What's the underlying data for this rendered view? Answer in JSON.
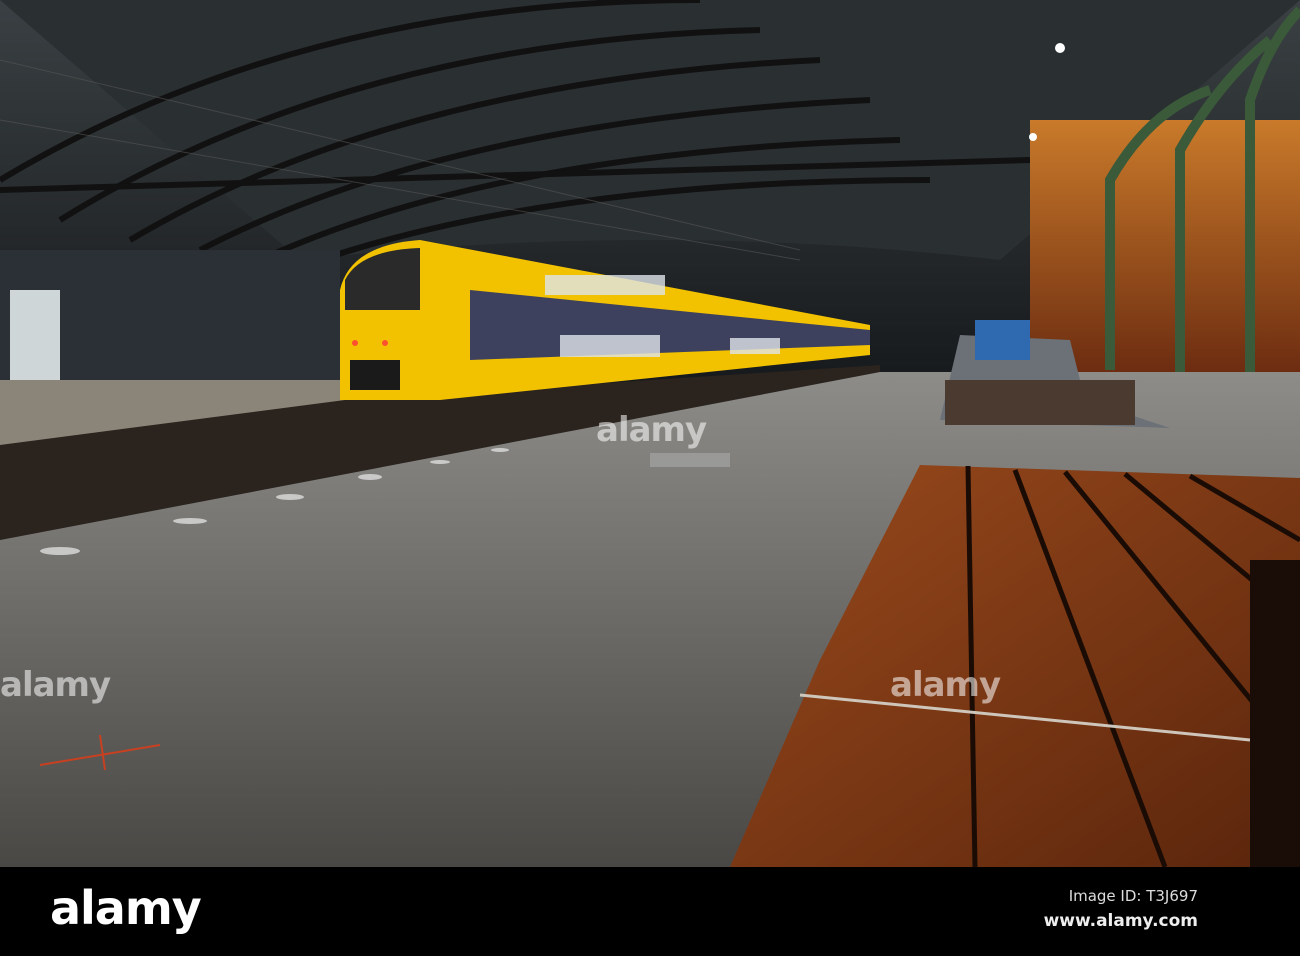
{
  "watermark": {
    "brand": "alamy"
  },
  "footer": {
    "logo": "alamy",
    "image_id": "Image ID: T3J697",
    "website": "www.alamy.com"
  },
  "colors": {
    "train_yellow": "#f2c200",
    "train_blue": "#1e2a6e",
    "bench_wood": "#7a3512",
    "platform": "#5e5b57"
  }
}
